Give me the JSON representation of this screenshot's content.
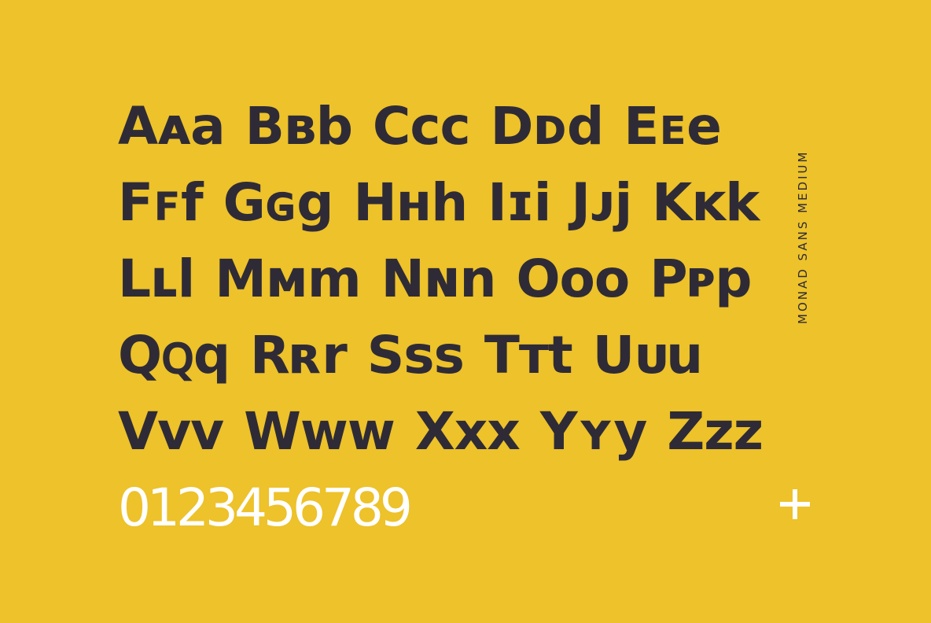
{
  "specimen": {
    "rows": [
      "Aᴀa Bʙb Cᴄc Dᴅd Eᴇe",
      "Fꜰf Gɢg Hʜh Iɪi Jᴊj Kᴋk",
      "Lʟl Mᴍm Nɴn Oᴏo Pᴘp",
      "Qꞯq Rʀr Sꜱs Tᴛt Uᴜu",
      "Vᴠv Wᴡw Xxx Yʏy Zᴢz"
    ],
    "digits": "0123456789"
  },
  "side_label": "MONAD SANS MEDIUM",
  "icons": {
    "plus": "plus-icon"
  },
  "colors": {
    "background": "#EDC22A",
    "text": "#2F2B36",
    "accent": "#FFFFFF"
  }
}
